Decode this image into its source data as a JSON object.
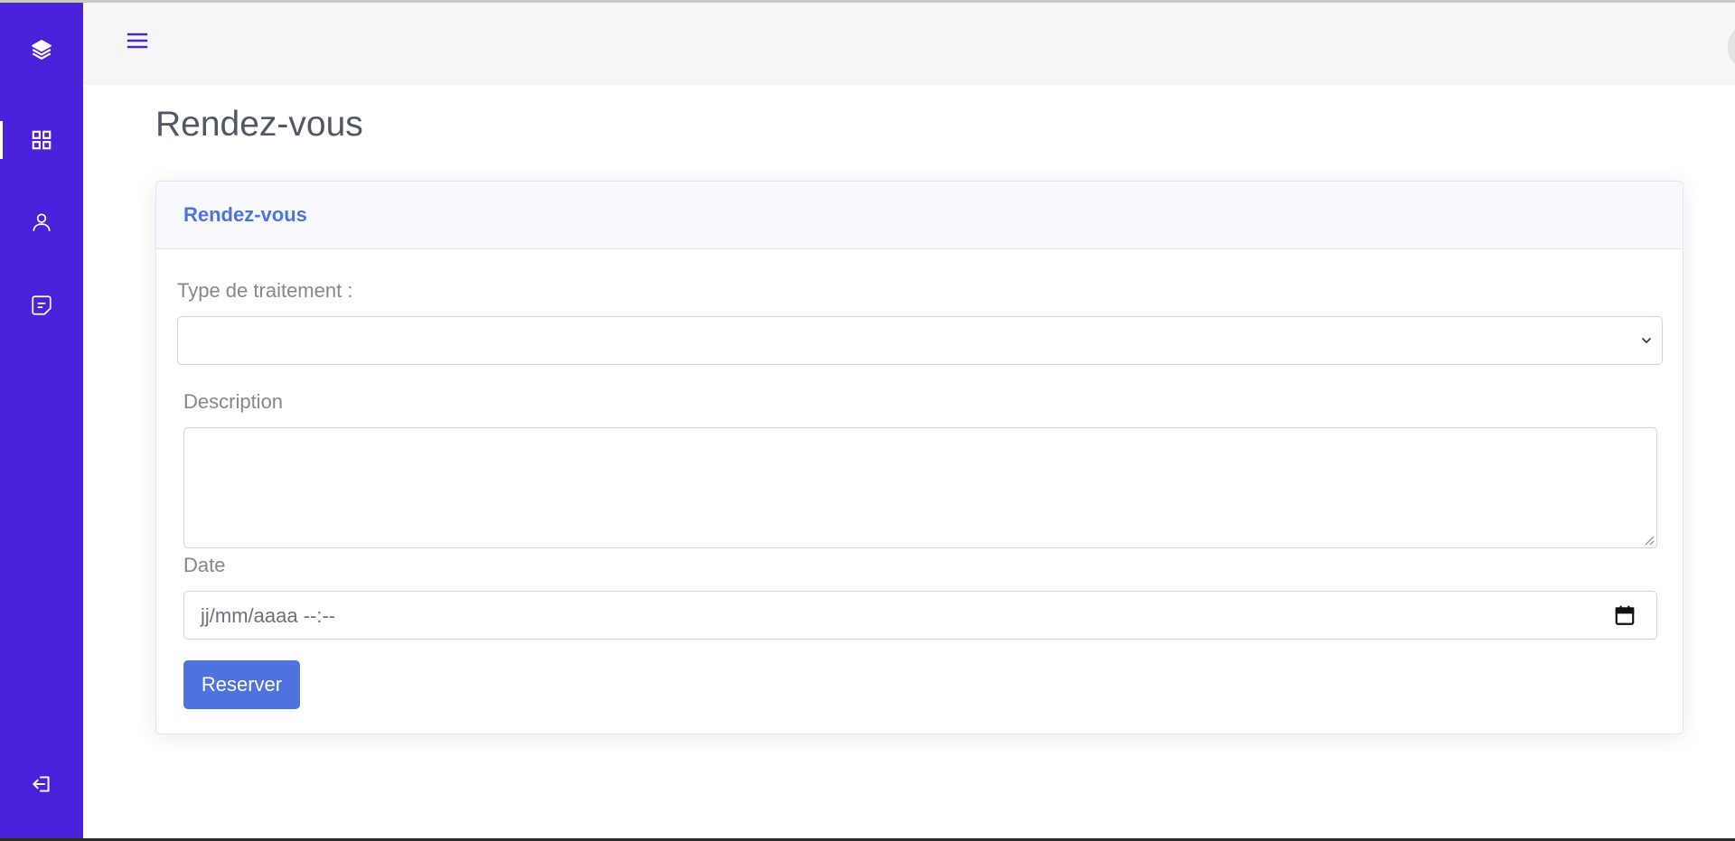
{
  "page": {
    "title": "Rendez-vous"
  },
  "sidebar": {
    "items": [
      {
        "icon": "layers-icon",
        "label": ""
      },
      {
        "icon": "grid-icon",
        "label": "",
        "active": true
      },
      {
        "icon": "user-icon",
        "label": ""
      },
      {
        "icon": "note-icon",
        "label": ""
      },
      {
        "icon": "logout-icon",
        "label": ""
      }
    ]
  },
  "topbar": {
    "menu_icon": "hamburger-menu-icon",
    "avatar": "user-avatar"
  },
  "card": {
    "title": "Rendez-vous",
    "fields": {
      "treatment_label": "Type de traitement :",
      "treatment_value": "",
      "description_label": "Description",
      "description_value": "",
      "date_label": "Date",
      "date_placeholder": "jj/mm/aaaa --:--"
    },
    "submit_label": "Reserver"
  },
  "colors": {
    "sidebar": "#4a22dc",
    "accent": "#4e73df",
    "topbar": "#f6f6f9"
  }
}
